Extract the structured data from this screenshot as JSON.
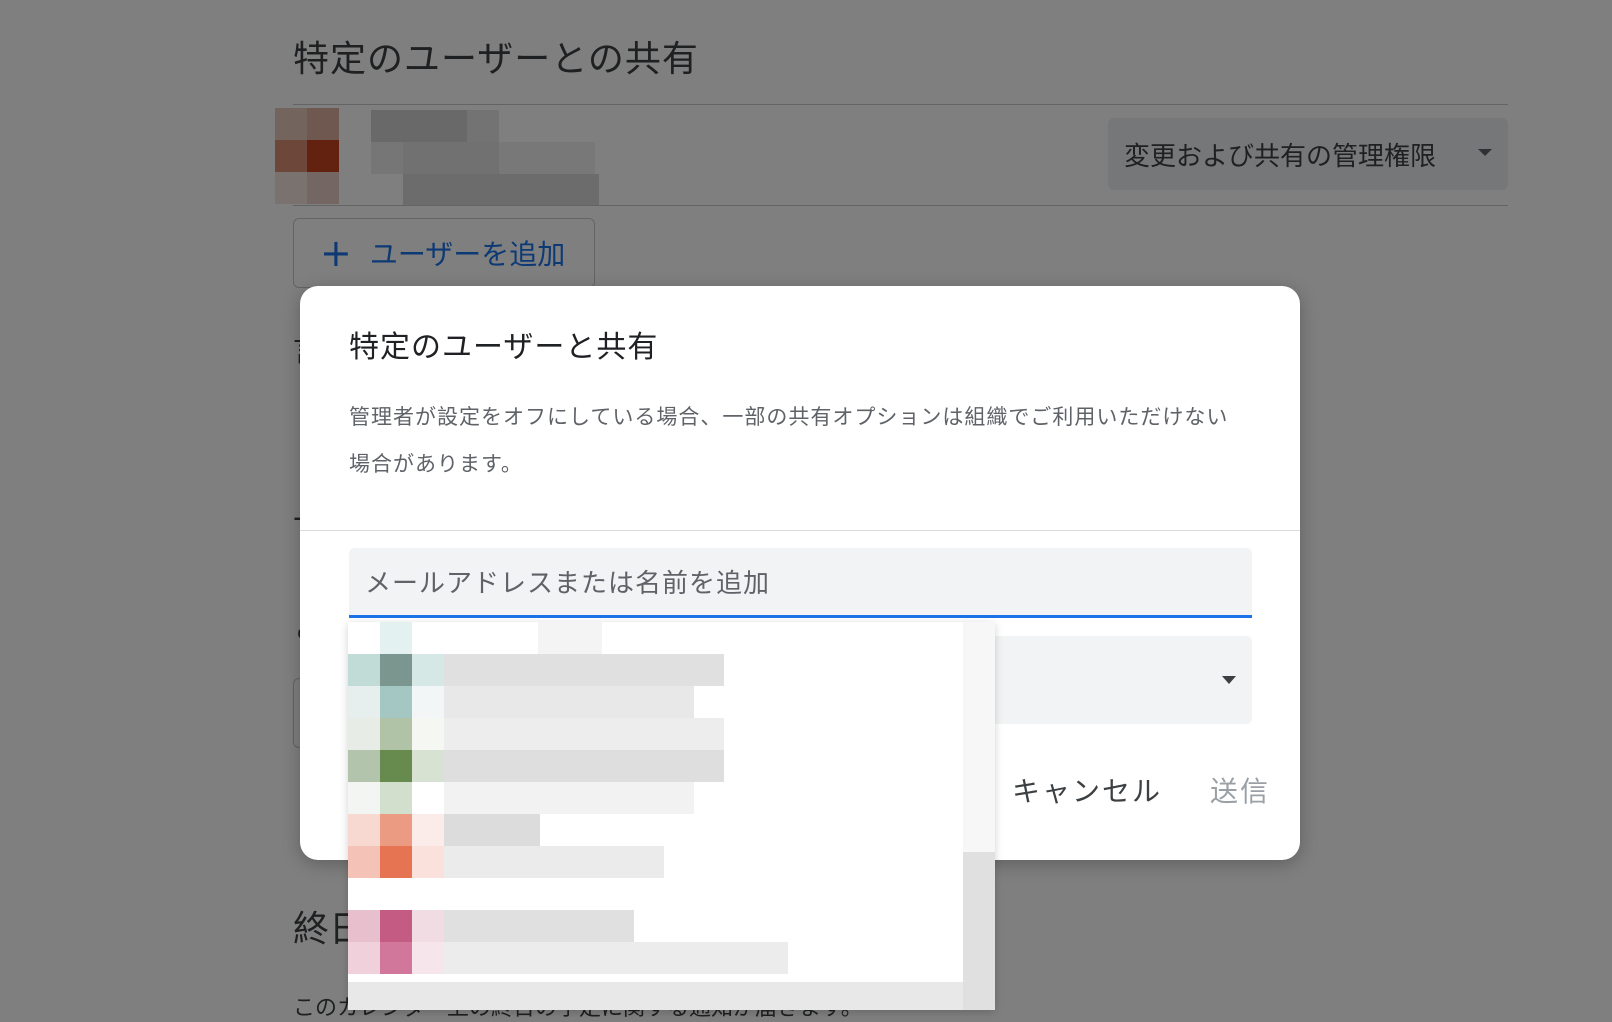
{
  "background": {
    "section_title": "特定のユーザーとの共有",
    "user_permission": "変更および共有の管理権限",
    "add_user_label": "ユーザーを追加",
    "add_user_icon": "plus-icon",
    "fragment_1": "言",
    "fragment_2": "-",
    "fragment_3": "こ",
    "section2_title": "終日",
    "bottom_text": "このカレンダー上の終日の予定に関する通知が届きます。"
  },
  "dialog": {
    "title": "特定のユーザーと共有",
    "description": "管理者が設定をオフにしている場合、一部の共有オプションは組織でご利用いただけない場合があります。",
    "email_placeholder": "メールアドレスまたは名前を追加",
    "cancel_label": "キャンセル",
    "send_label": "送信"
  },
  "colors": {
    "accent": "#1a73e8",
    "scrim": "rgba(0,0,0,0.5)"
  }
}
